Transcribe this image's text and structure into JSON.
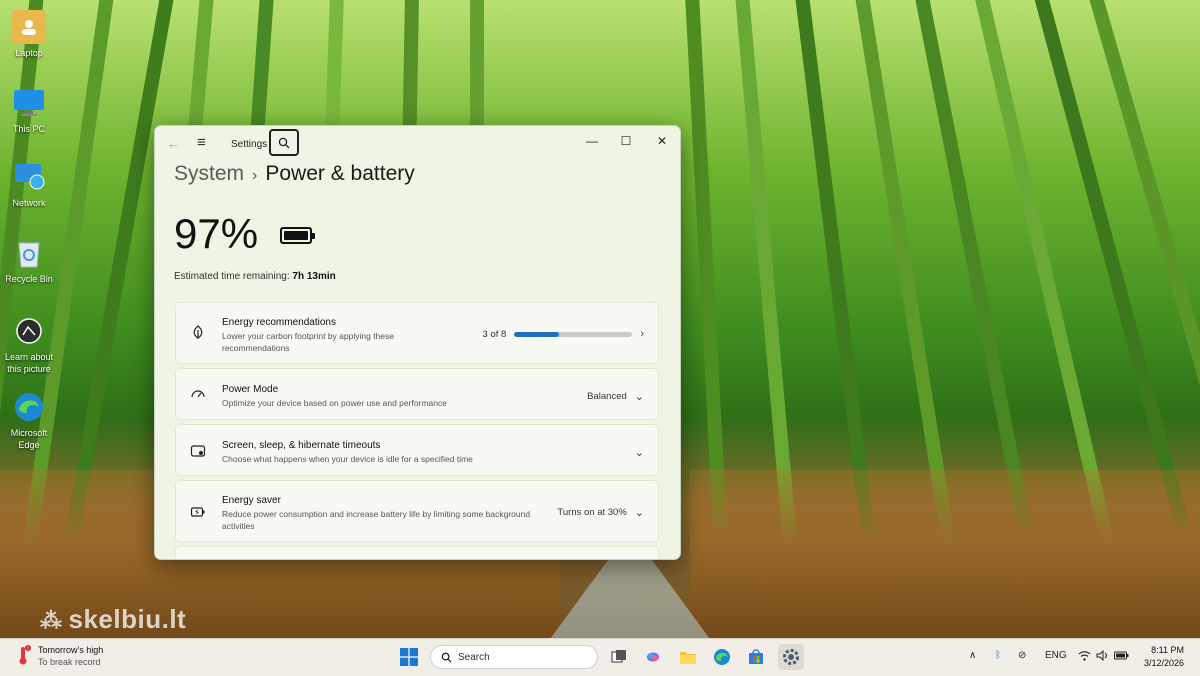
{
  "desktop": {
    "icons": [
      {
        "label": "Laptop",
        "icon": "user-folder-icon"
      },
      {
        "label": "This PC",
        "icon": "monitor-icon"
      },
      {
        "label": "Network",
        "icon": "network-icon"
      },
      {
        "label": "Recycle Bin",
        "icon": "recycle-bin-icon"
      },
      {
        "label": "Learn about this picture",
        "icon": "camera-icon"
      },
      {
        "label": "Microsoft Edge",
        "icon": "edge-icon"
      }
    ],
    "watermark": "skelbiu.lt"
  },
  "window": {
    "title": "Settings",
    "breadcrumb_parent": "System",
    "breadcrumb_separator": "›",
    "page_title": "Power & battery",
    "battery_percent": "97%",
    "estimated_label": "Estimated time remaining:",
    "estimated_value": "7h 13min",
    "cards": [
      {
        "title": "Energy recommendations",
        "desc": "Lower your carbon footprint by applying these recommendations",
        "value": "3 of 8",
        "progress": 0.375,
        "icon": "leaf-icon"
      },
      {
        "title": "Power Mode",
        "desc": "Optimize your device based on power use and performance",
        "value": "Balanced",
        "icon": "power-mode-icon"
      },
      {
        "title": "Screen, sleep, & hibernate timeouts",
        "desc": "Choose what happens when your device is idle for a specified time",
        "value": "",
        "icon": "screen-sleep-icon"
      },
      {
        "title": "Energy saver",
        "desc": "Reduce power consumption and increase battery life by limiting some background activities",
        "value": "Turns on at 30%",
        "icon": "energy-saver-icon"
      }
    ]
  },
  "taskbar": {
    "weather_title": "Tomorrow's high",
    "weather_sub": "To break record",
    "search_placeholder": "Search",
    "language": "ENG",
    "time": "8:11 PM",
    "date": "3/12/2026"
  },
  "colors": {
    "accent": "#1f6fc0",
    "window_bg": "#eef5e4",
    "taskbar_bg": "#f0eee7"
  }
}
